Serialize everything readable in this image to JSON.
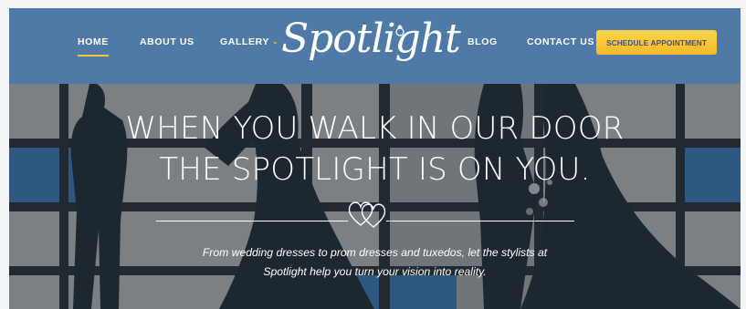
{
  "nav": {
    "items": [
      {
        "label": "HOME",
        "active": true
      },
      {
        "label": "ABOUT US",
        "active": false
      },
      {
        "label": "GALLERY",
        "active": false,
        "has_dropdown": true
      },
      {
        "label": "BLOG",
        "active": false
      },
      {
        "label": "CONTACT US",
        "active": false
      }
    ],
    "cta_label": "SCHEDULE APPOINTMENT"
  },
  "logo": {
    "text": "Spotlight"
  },
  "hero": {
    "headline_line1": "WHEN YOU WALK IN OUR DOOR",
    "headline_line2": "THE SPOTLIGHT IS ON YOU.",
    "subtext_line1": "From wedding dresses to prom dresses and tuxedos, let the stylists at",
    "subtext_line2": "Spotlight help you turn your vision into reality."
  },
  "colors": {
    "navbar": "#4f7aa8",
    "accent": "#f3c143",
    "cta_text": "#3f4f7a"
  },
  "icons": [
    "chevron-down-icon",
    "hearts-icon",
    "diamond-ring-icon"
  ]
}
